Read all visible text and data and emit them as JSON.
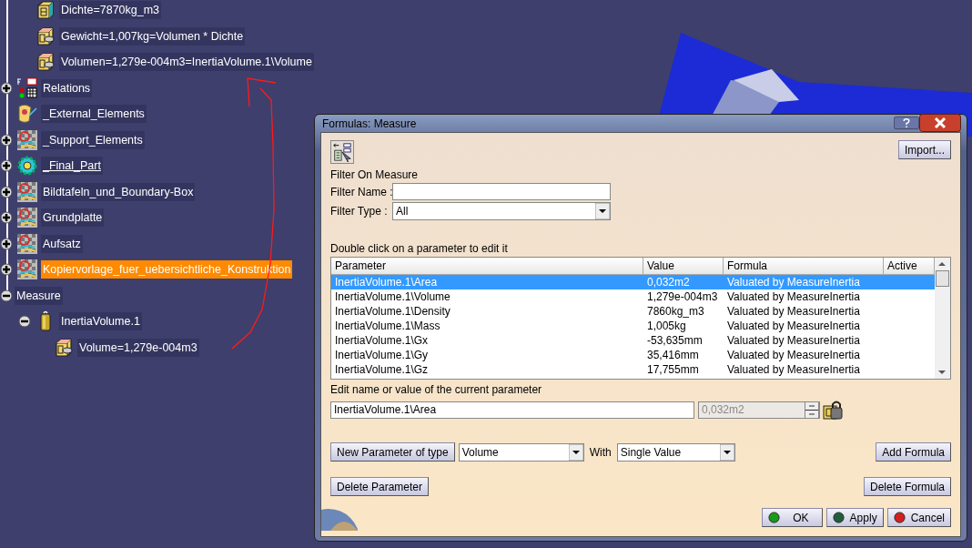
{
  "tree": {
    "partial_branch": [
      {
        "label": "Dichte=7870kg_m3",
        "kind": "parameter"
      },
      {
        "label": "Gewicht=1,007kg=Volumen * Dichte",
        "kind": "formula"
      },
      {
        "label": "Volumen=1,279e-004m3=InertiaVolume.1\\Volume",
        "kind": "formula"
      }
    ],
    "nodes": [
      {
        "label": "Relations",
        "kind": "relations",
        "expanded": false,
        "selected": false,
        "in_work": false
      },
      {
        "label": "_External_Elements",
        "kind": "external",
        "selected": false,
        "in_work": false
      },
      {
        "label": "_Support_Elements",
        "kind": "body",
        "expanded": false,
        "selected": false,
        "in_work": false
      },
      {
        "label": "_Final_Part",
        "kind": "gear",
        "expanded": false,
        "selected": false,
        "in_work": true
      },
      {
        "label": "Bildtafeln_und_Boundary-Box",
        "kind": "body",
        "expanded": false,
        "selected": false,
        "in_work": false
      },
      {
        "label": "Grundplatte",
        "kind": "body",
        "expanded": false,
        "selected": false,
        "in_work": false
      },
      {
        "label": "Aufsatz",
        "kind": "body",
        "expanded": false,
        "selected": false,
        "in_work": false
      },
      {
        "label": "Kopiervorlage_fuer_uebersichtliche_Konstruktion",
        "kind": "body",
        "expanded": false,
        "selected": true,
        "in_work": false
      },
      {
        "label": "Measure",
        "kind": "group",
        "expanded": true,
        "selected": false,
        "in_work": false,
        "children": [
          {
            "label": "InertiaVolume.1",
            "kind": "weight",
            "expanded": true,
            "selected": false,
            "in_work": false,
            "children": [
              {
                "label": "Volume=1,279e-004m3",
                "kind": "formula",
                "selected": false,
                "in_work": false
              }
            ]
          }
        ]
      }
    ]
  },
  "dialog": {
    "title": "Formulas: Measure",
    "import_button": "Import...",
    "filter_heading": "Filter On Measure",
    "filter_name_label": "Filter Name :",
    "filter_type_label": "Filter Type :",
    "filter_type_value": "All",
    "table_hint": "Double click on a parameter to edit it",
    "table": {
      "columns": [
        "Parameter",
        "Value",
        "Formula",
        "Active"
      ],
      "rows": [
        {
          "parameter": "InertiaVolume.1\\Area",
          "value": "0,032m2",
          "formula": "Valuated by MeasureInertia",
          "selected": true
        },
        {
          "parameter": "InertiaVolume.1\\Volume",
          "value": "1,279e-004m3",
          "formula": "Valuated by MeasureInertia",
          "selected": false
        },
        {
          "parameter": "InertiaVolume.1\\Density",
          "value": "7860kg_m3",
          "formula": "Valuated by MeasureInertia",
          "selected": false
        },
        {
          "parameter": "InertiaVolume.1\\Mass",
          "value": "1,005kg",
          "formula": "Valuated by MeasureInertia",
          "selected": false
        },
        {
          "parameter": "InertiaVolume.1\\Gx",
          "value": "-53,635mm",
          "formula": "Valuated by MeasureInertia",
          "selected": false
        },
        {
          "parameter": "InertiaVolume.1\\Gy",
          "value": "35,416mm",
          "formula": "Valuated by MeasureInertia",
          "selected": false
        },
        {
          "parameter": "InertiaVolume.1\\Gz",
          "value": "17,755mm",
          "formula": "Valuated by MeasureInertia",
          "selected": false
        }
      ]
    },
    "edit_label": "Edit name or value of the current parameter",
    "edit_name": "InertiaVolume.1\\Area",
    "edit_value": "0,032m2",
    "edit_value_disabled": true,
    "new_parameter_button": "New Parameter of type",
    "parameter_type": "Volume",
    "with_label": "With",
    "value_kind": "Single Value",
    "add_formula_button": "Add Formula",
    "delete_parameter_button": "Delete Parameter",
    "delete_formula_button": "Delete Formula",
    "buttons": [
      {
        "label": "OK",
        "color": "#1a9a1a"
      },
      {
        "label": "Apply",
        "color": "#1f5e3a"
      },
      {
        "label": "Cancel",
        "color": "#d42020"
      }
    ]
  }
}
